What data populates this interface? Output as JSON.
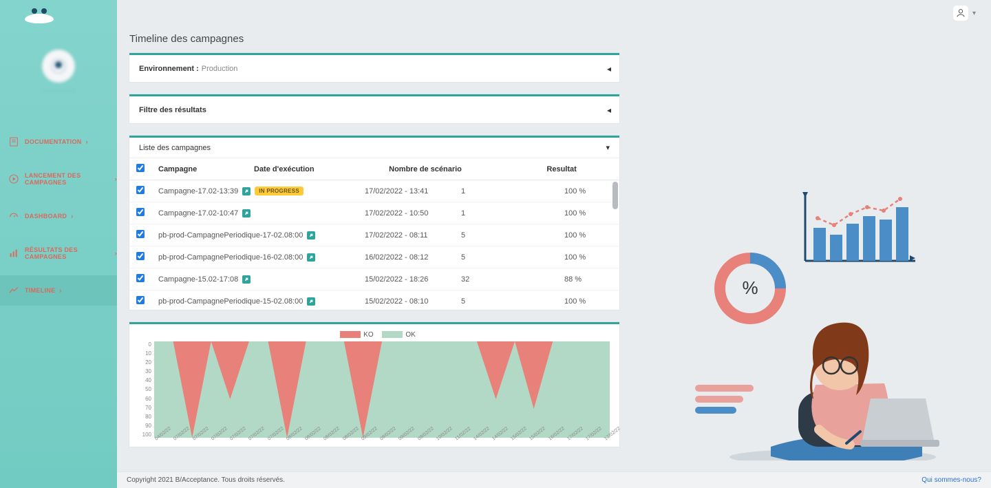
{
  "header": {
    "user_menu_caret": "▾"
  },
  "sidebar": {
    "tenant_name": "· · · · · · · ·",
    "items": [
      {
        "label": "DOCUMENTATION"
      },
      {
        "label": "LANCEMENT DES CAMPAGNES"
      },
      {
        "label": "DASHBOARD"
      },
      {
        "label": "RÉSULTATS DES CAMPAGNES"
      },
      {
        "label": "TIMELINE"
      }
    ]
  },
  "page": {
    "title": "Timeline des campagnes",
    "env_label": "Environnement :",
    "env_value": "Production",
    "filter_label": "Filtre des résultats",
    "list_title": "Liste des campagnes",
    "columns": {
      "name": "Campagne",
      "date": "Date d'exécution",
      "count": "Nombre de scénario",
      "result": "Resultat"
    },
    "rows": [
      {
        "name": "Campagne-17.02-13:39",
        "badge": "IN PROGRESS",
        "date": "17/02/2022 - 13:41",
        "count": "1",
        "result": "100 %"
      },
      {
        "name": "Campagne-17.02-10:47",
        "badge": "",
        "date": "17/02/2022 - 10:50",
        "count": "1",
        "result": "100 %"
      },
      {
        "name": "pb-prod-CampagnePeriodique-17-02.08:00",
        "badge": "",
        "date": "17/02/2022 - 08:11",
        "count": "5",
        "result": "100 %"
      },
      {
        "name": "pb-prod-CampagnePeriodique-16-02.08:00",
        "badge": "",
        "date": "16/02/2022 - 08:12",
        "count": "5",
        "result": "100 %"
      },
      {
        "name": "Campagne-15.02-17:08",
        "badge": "",
        "date": "15/02/2022 - 18:26",
        "count": "32",
        "result": "88 %"
      },
      {
        "name": "pb-prod-CampagnePeriodique-15-02.08:00",
        "badge": "",
        "date": "15/02/2022 - 08:10",
        "count": "5",
        "result": "100 %"
      }
    ]
  },
  "chart_data": {
    "type": "area",
    "title": "",
    "legend": [
      "KO",
      "OK"
    ],
    "ylabel": "",
    "ylim": [
      0,
      100
    ],
    "yticks": [
      0,
      10,
      20,
      30,
      40,
      50,
      60,
      70,
      80,
      90,
      100
    ],
    "x": [
      "04/02/22",
      "07/02/22",
      "07/02/22",
      "07/02/22",
      "07/02/22",
      "07/02/22",
      "07/02/22",
      "08/02/22",
      "08/02/22",
      "08/02/22",
      "08/02/22",
      "09/02/22",
      "09/02/22",
      "09/02/22",
      "09/02/22",
      "10/02/22",
      "11/02/22",
      "14/02/22",
      "14/02/22",
      "15/02/22",
      "15/02/22",
      "16/02/22",
      "17/02/22",
      "17/02/22",
      "17/02/22"
    ],
    "series": [
      {
        "name": "KO",
        "values": [
          0,
          0,
          100,
          0,
          60,
          0,
          0,
          100,
          0,
          0,
          0,
          100,
          0,
          0,
          0,
          0,
          0,
          0,
          60,
          0,
          70,
          0,
          0,
          0,
          0
        ]
      },
      {
        "name": "OK",
        "values": [
          100,
          100,
          0,
          100,
          40,
          100,
          100,
          0,
          100,
          100,
          100,
          0,
          100,
          100,
          100,
          100,
          100,
          100,
          40,
          100,
          30,
          100,
          100,
          100,
          100
        ]
      }
    ],
    "colors": {
      "KO": "#e8817a",
      "OK": "#b2d9c5"
    }
  },
  "footer": {
    "copyright": "Copyright 2021 B/Acceptance. Tous droits réservés.",
    "link": "Qui sommes-nous?"
  }
}
